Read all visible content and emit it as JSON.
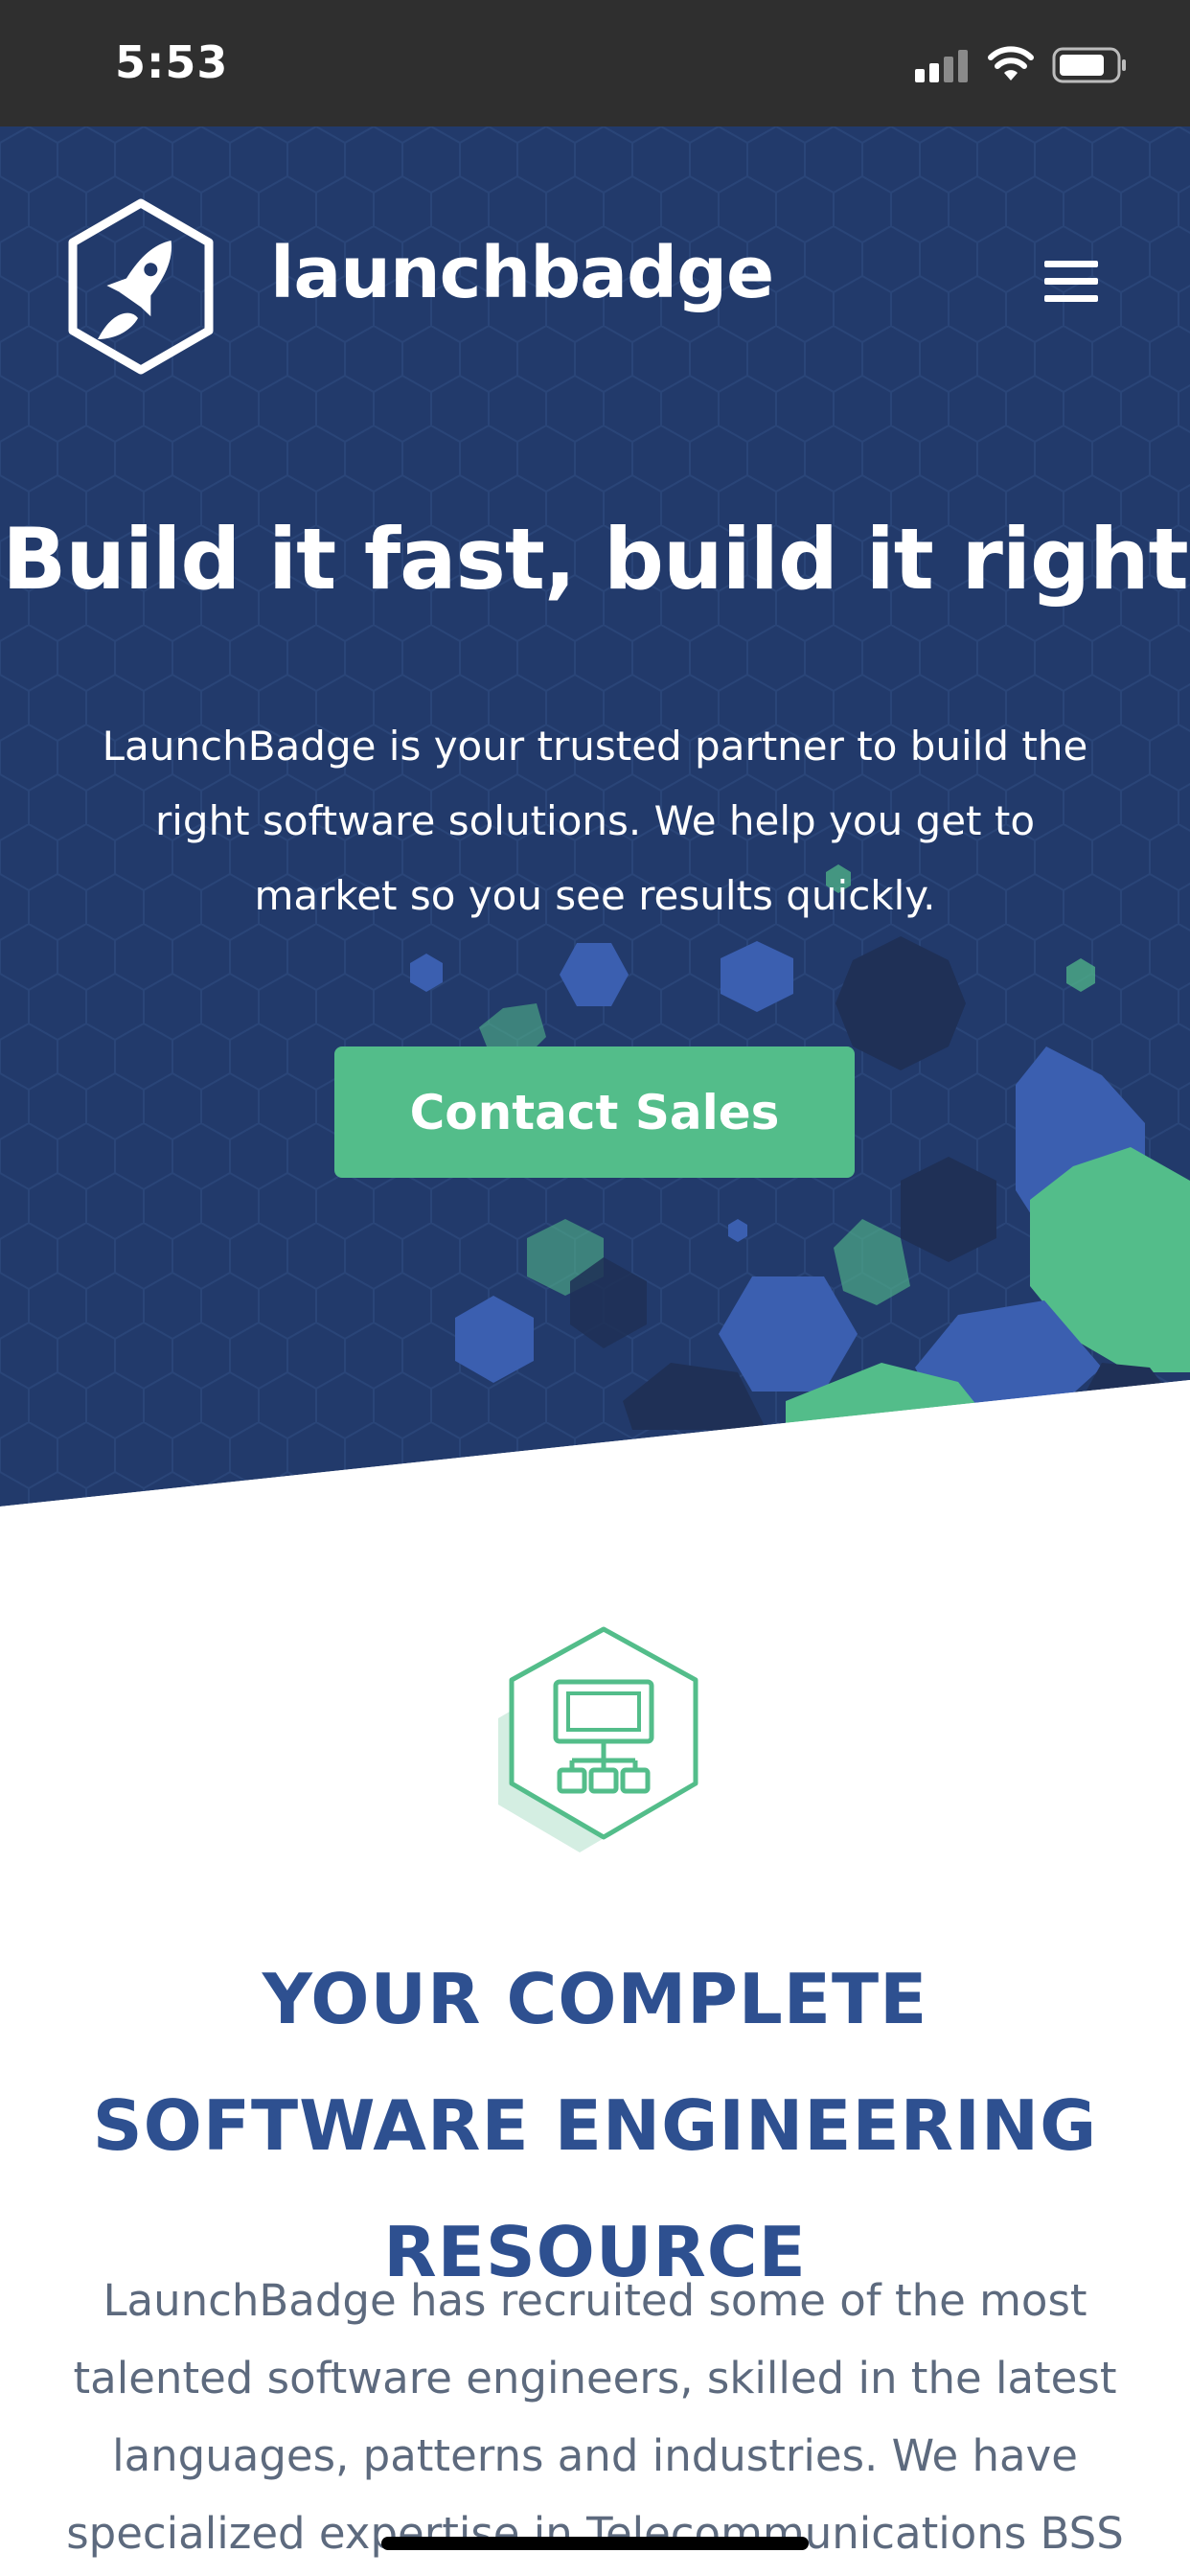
{
  "status_bar": {
    "time": "5:53"
  },
  "header": {
    "brand_name": "launchbadge"
  },
  "hero": {
    "title": "Build it fast, build it right",
    "description": "LaunchBadge is your trusted partner to build the right software solutions. We help you get to market so you see results quickly.",
    "cta_label": "Contact Sales"
  },
  "feature": {
    "icon": "network-diagram-icon",
    "title": "YOUR COMPLETE SOFTWARE ENGINEERING RESOURCE",
    "description": "LaunchBadge has recruited some of the most talented software engineers, skilled in the latest languages, patterns and industries. We have specialized expertise in Telecommunications BSS and"
  },
  "colors": {
    "navy": "#223a6b",
    "green": "#53bd8a",
    "blue": "#3b5fb0",
    "heading_blue": "#2e5090"
  }
}
